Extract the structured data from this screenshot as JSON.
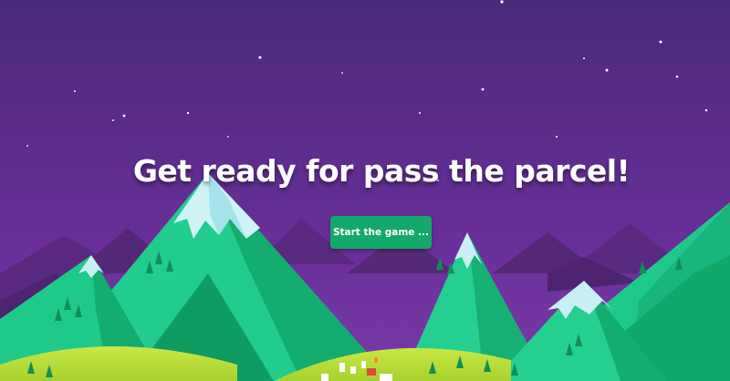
{
  "screen": {
    "headline": "Get ready for pass the parcel!",
    "start_button_label": "Start the game ..."
  },
  "colors": {
    "sky_top": "#4a2a7a",
    "sky_bottom": "#6f34a0",
    "mountain_green": "#1fc98a",
    "mountain_shadow": "#10a86a",
    "snow": "#c8f0f4",
    "meadow": "#b7e03a",
    "button": "#14a86a",
    "text": "#ffffff"
  }
}
